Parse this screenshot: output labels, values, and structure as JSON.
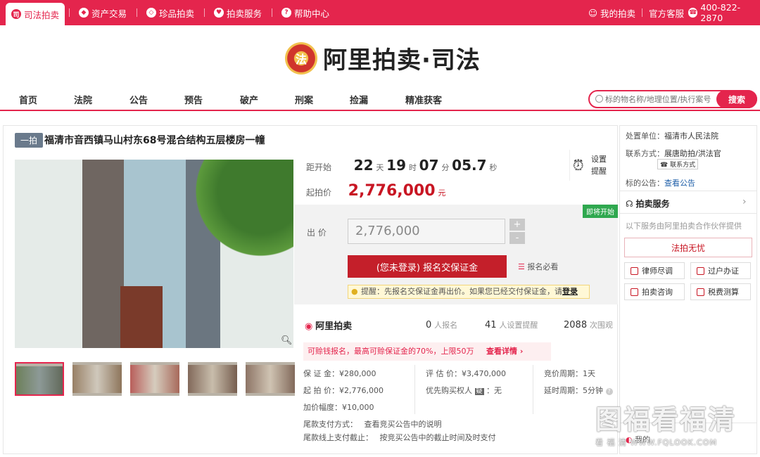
{
  "topbar": {
    "tabs": [
      {
        "label": "司法拍卖",
        "icon": "gavel-icon",
        "glyph": "司"
      },
      {
        "label": "资产交易",
        "icon": "asset-icon",
        "glyph": "◆"
      },
      {
        "label": "珍品拍卖",
        "icon": "treasure-icon",
        "glyph": "◇"
      },
      {
        "label": "拍卖服务",
        "icon": "heart-icon",
        "glyph": "♥"
      },
      {
        "label": "帮助中心",
        "icon": "help-icon",
        "glyph": "?"
      }
    ],
    "my_auction": "我的拍卖",
    "service": "官方客服",
    "phone": "400-822-2870"
  },
  "logo": {
    "text": "阿里拍卖·司法",
    "emblem_glyph": "法"
  },
  "nav": {
    "items": [
      "首页",
      "法院",
      "公告",
      "预告",
      "破产",
      "刑案",
      "捡漏",
      "精准获客"
    ],
    "search_placeholder": "标的物名称/地理位置/执行案号",
    "search_button": "搜索"
  },
  "lot": {
    "badge": "一拍",
    "title": "福清市音西镇马山村东68号混合结构五层楼房一幢"
  },
  "countdown": {
    "label": "距开始",
    "days": "22",
    "days_unit": "天",
    "hours": "19",
    "hours_unit": "时",
    "minutes": "07",
    "minutes_unit": "分",
    "seconds": "05.7",
    "seconds_unit": "秒",
    "remind_line1": "设置",
    "remind_line2": "提醒"
  },
  "start_price": {
    "label": "起拍价",
    "value": "2,776,000",
    "unit": "元"
  },
  "bid": {
    "status_badge": "即将开始",
    "label": "出 价",
    "input_value": "2,776,000",
    "plus": "+",
    "minus": "-",
    "signup_button": "(您未登录) 报名交保证金",
    "must_read": "报名必看",
    "tip_text": "提醒：先报名交保证金再出价。如果您已经交付保证金，请",
    "tip_login": "登录"
  },
  "stats": {
    "brand": "阿里拍卖",
    "signups_num": "0",
    "signups_lbl": "人报名",
    "reminders_num": "41",
    "reminders_lbl": "人设置提醒",
    "views_num": "2088",
    "views_lbl": "次围观"
  },
  "promo": {
    "text": "可赊钱报名，最高可赊保证金的70%，上限50万",
    "link": "查看详情 ›"
  },
  "details": {
    "deposit": "保 证 金：¥280,000",
    "appraisal": "评 估 价：¥3,470,000",
    "cycle": "竞价周期：1天",
    "start": "起 拍 价：¥2,776,000",
    "priority": "优先购买权人",
    "priority_badge": "疑",
    "priority_val": "：无",
    "delay": "延时周期：5分钟",
    "increment": "加价幅度：¥10,000",
    "pay_method_lbl": "尾款支付方式：",
    "pay_method_val": "查看竞买公告中的说明",
    "deadline_lbl": "尾款线上支付截止：",
    "deadline_val": "按竞买公告中的截止时间及时支付"
  },
  "sidebar": {
    "unit_lbl": "处置单位：",
    "unit_val": "福清市人民法院",
    "contact_lbl": "联系方式：",
    "contact_val": "展唐助拍/洪法官",
    "contact_btn": "联系方式",
    "notice_lbl": "标的公告：",
    "notice_link": "查看公告",
    "svc_title": "拍卖服务",
    "svc_desc": "以下服务由阿里拍卖合作伙伴提供",
    "worry_free": "法拍无忧",
    "buttons": [
      "律师尽调",
      "过户办证",
      "拍卖咨询",
      "税费测算"
    ],
    "my_item": "我的"
  },
  "watermark": {
    "big": "图福看福清",
    "small": "看 福 清  WWW.FQLOOK.COM"
  }
}
